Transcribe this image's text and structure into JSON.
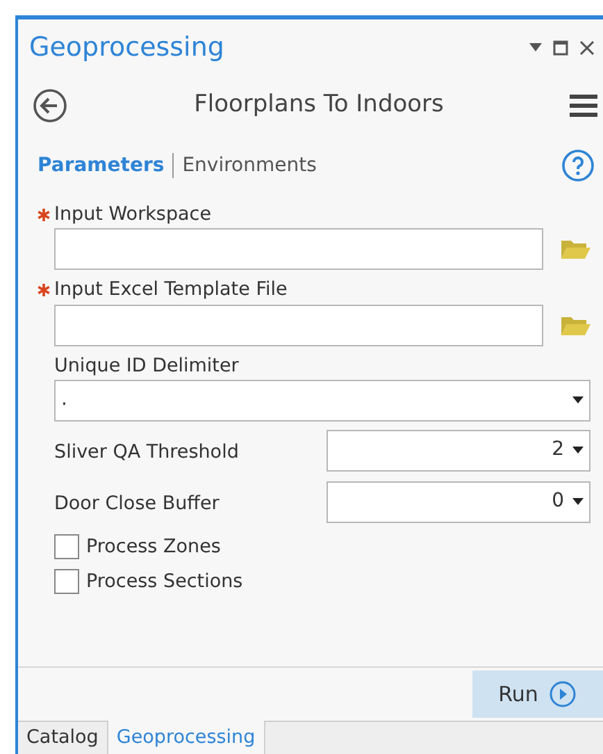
{
  "pane": {
    "title": "Geoprocessing"
  },
  "tool": {
    "title": "Floorplans To Indoors"
  },
  "tabs": [
    {
      "label": "Parameters",
      "selected": true
    },
    {
      "label": "Environments",
      "selected": false
    }
  ],
  "parameters": [
    {
      "kind": "file",
      "label": "Input Workspace",
      "required": true
    },
    {
      "kind": "file",
      "label": "Input Excel Template File",
      "required": true
    },
    {
      "kind": "dropdown",
      "label": "Unique ID Delimiter",
      "required": false,
      "value": "."
    },
    {
      "kind": "inline",
      "label": "Sliver QA Threshold",
      "required": false,
      "value": "2"
    },
    {
      "kind": "inline",
      "label": "Door Close Buffer",
      "required": false,
      "value": "0"
    },
    {
      "kind": "checkbox",
      "label": "Process Zones",
      "checked": false
    },
    {
      "kind": "checkbox",
      "label": "Process Sections",
      "checked": false
    }
  ],
  "run_button": {
    "label": "Run"
  },
  "bottom_tabs": [
    {
      "label": "Catalog",
      "selected": false
    },
    {
      "label": "Geoprocessing",
      "selected": true
    }
  ]
}
